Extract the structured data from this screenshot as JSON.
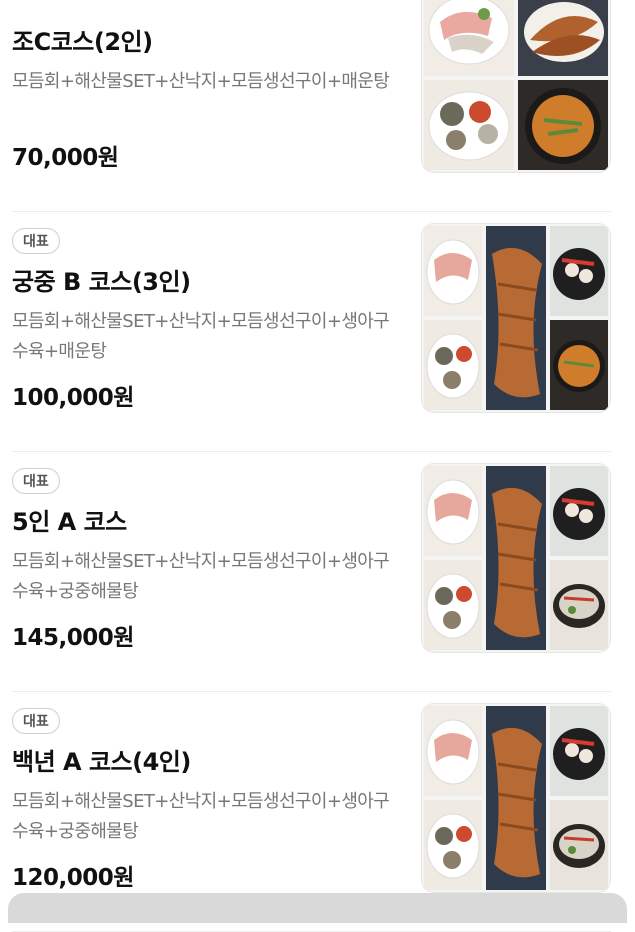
{
  "menu": {
    "items": [
      {
        "badge": "",
        "name": "조C코스(2인)",
        "description": "모듬회+해산물SET+산낙지+모듬생선구이+매운탕",
        "price": "70,000원",
        "photo": "four-dish-collage"
      },
      {
        "badge": "대표",
        "name": "궁중 B 코스(3인)",
        "description": "모듬회+해산물SET+산낙지+모듬생선구이+생아구수육+매운탕",
        "price": "100,000원",
        "photo": "five-dish-collage-stew"
      },
      {
        "badge": "대표",
        "name": "5인 A 코스",
        "description": "모듬회+해산물SET+산낙지+모듬생선구이+생아구수육+궁중해물탕",
        "price": "145,000원",
        "photo": "five-dish-collage-seafood-pot"
      },
      {
        "badge": "대표",
        "name": "백년 A 코스(4인)",
        "description": "모듬회+해산물SET+산낙지+모듬생선구이+생아구수육+궁중해물탕",
        "price": "120,000원",
        "photo": "five-dish-collage-seafood-pot"
      }
    ]
  }
}
